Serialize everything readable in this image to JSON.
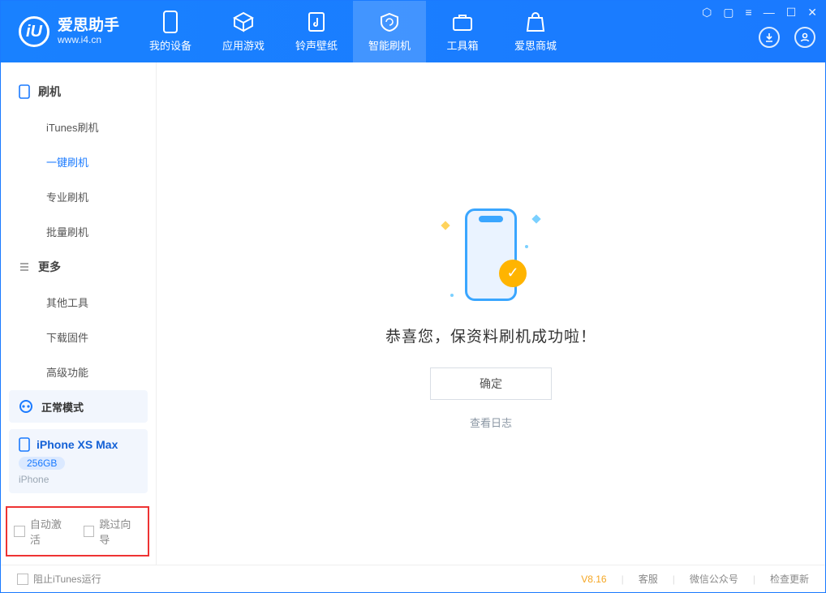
{
  "app": {
    "name": "爱思助手",
    "url": "www.i4.cn"
  },
  "tabs": [
    {
      "label": "我的设备"
    },
    {
      "label": "应用游戏"
    },
    {
      "label": "铃声壁纸"
    },
    {
      "label": "智能刷机"
    },
    {
      "label": "工具箱"
    },
    {
      "label": "爱思商城"
    }
  ],
  "sidebar": {
    "group_flash": "刷机",
    "items_flash": [
      {
        "label": "iTunes刷机"
      },
      {
        "label": "一键刷机"
      },
      {
        "label": "专业刷机"
      },
      {
        "label": "批量刷机"
      }
    ],
    "group_more": "更多",
    "items_more": [
      {
        "label": "其他工具"
      },
      {
        "label": "下载固件"
      },
      {
        "label": "高级功能"
      }
    ]
  },
  "mode": {
    "label": "正常模式"
  },
  "device": {
    "name": "iPhone XS Max",
    "capacity": "256GB",
    "type": "iPhone"
  },
  "skip": {
    "auto_activate": "自动激活",
    "skip_guide": "跳过向导"
  },
  "main": {
    "success": "恭喜您，保资料刷机成功啦！",
    "ok": "确定",
    "view_log": "查看日志"
  },
  "footer": {
    "block_itunes": "阻止iTunes运行",
    "version": "V8.16",
    "service": "客服",
    "wechat": "微信公众号",
    "check_update": "检查更新"
  }
}
